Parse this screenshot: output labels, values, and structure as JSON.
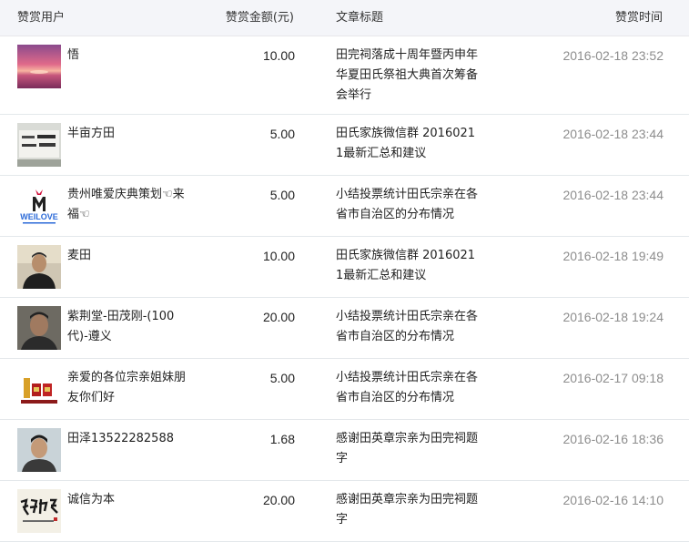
{
  "header": {
    "user": "赞赏用户",
    "amount": "赞赏金额(元)",
    "title": "文章标题",
    "time": "赞赏时间"
  },
  "rows": [
    {
      "name": "悟",
      "amount": "10.00",
      "title": "田完祠落成十周年暨丙申年华夏田氏祭祖大典首次筹备会举行",
      "time": "2016-02-18 23:52",
      "avatar_icon": "sunset-avatar-icon"
    },
    {
      "name": "半亩方田",
      "amount": "5.00",
      "title": "田氏家族微信群 20160211最新汇总和建议",
      "time": "2016-02-18 23:44",
      "avatar_icon": "sign-board-avatar-icon"
    },
    {
      "name": "贵州唯爱庆典策划☜来福☜",
      "amount": "5.00",
      "title": "小结投票统计田氏宗亲在各省市自治区的分布情况",
      "time": "2016-02-18 23:44",
      "avatar_icon": "weilove-logo-avatar-icon",
      "logo_text": "WEILOVE"
    },
    {
      "name": "麦田",
      "amount": "10.00",
      "title": "田氏家族微信群 20160211最新汇总和建议",
      "time": "2016-02-18 19:49",
      "avatar_icon": "man-portrait-avatar-icon"
    },
    {
      "name": "紫荆堂-田茂刚-(100代)-遵义",
      "amount": "20.00",
      "title": "小结投票统计田氏宗亲在各省市自治区的分布情况",
      "time": "2016-02-18 19:24",
      "avatar_icon": "man-portrait-avatar-icon"
    },
    {
      "name": "亲爱的各位宗亲姐妹朋友你们好",
      "amount": "5.00",
      "title": "小结投票统计田氏宗亲在各省市自治区的分布情况",
      "time": "2016-02-17 09:18",
      "avatar_icon": "product-boxes-avatar-icon"
    },
    {
      "name": "田泽13522282588",
      "amount": "1.68",
      "title": "感谢田英章宗亲为田完祠题字",
      "time": "2016-02-16 18:36",
      "avatar_icon": "man-portrait-avatar-icon"
    },
    {
      "name": "诚信为本",
      "amount": "20.00",
      "title": "感谢田英章宗亲为田完祠题字",
      "time": "2016-02-16 14:10",
      "avatar_icon": "calligraphy-avatar-icon"
    }
  ],
  "colors": {
    "header_bg": "#f4f5f9",
    "divider": "#e4e8eb",
    "time_text": "#8d8d8d",
    "body_text": "#222222"
  }
}
